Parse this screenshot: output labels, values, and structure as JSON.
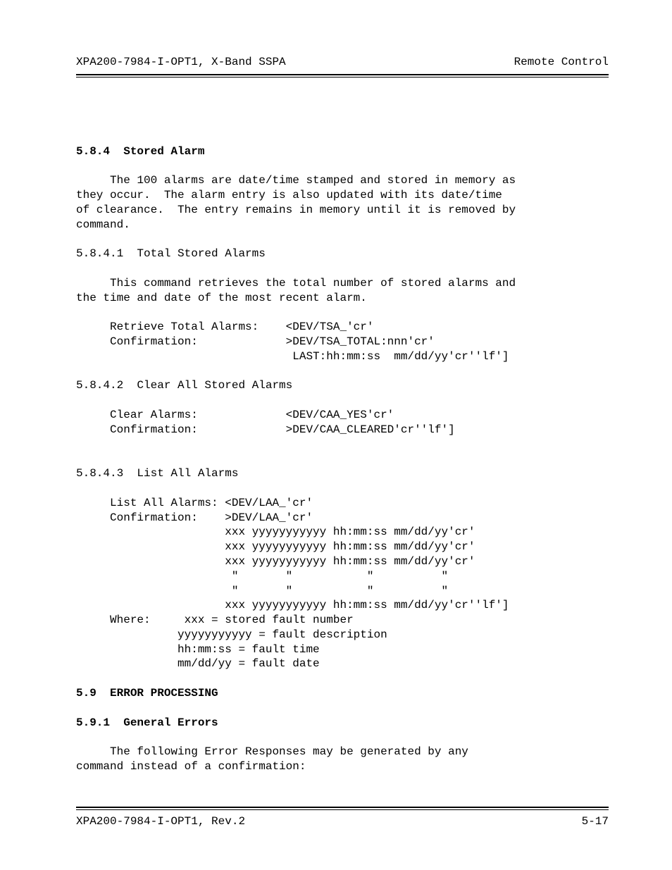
{
  "header": {
    "left": "XPA200-7984-I-OPT1, X-Band SSPA",
    "right": "Remote Control"
  },
  "footer": {
    "left": "XPA200-7984-I-OPT1, Rev.2",
    "right": "5-17"
  },
  "s584": {
    "num": "5.8.4  Stored Alarm",
    "para": "     The 100 alarms are date/time stamped and stored in memory as\nthey occur.  The alarm entry is also updated with its date/time\nof clearance.  The entry remains in memory until it is removed by\ncommand."
  },
  "s5841": {
    "title": "5.8.4.1  Total Stored Alarms",
    "para": "     This command retrieves the total number of stored alarms and\nthe time and date of the most recent alarm.",
    "block": "     Retrieve Total Alarms:    <DEV/TSA_'cr'\n     Confirmation:             >DEV/TSA_TOTAL:nnn'cr'\n                                LAST:hh:mm:ss  mm/dd/yy'cr''lf']"
  },
  "s5842": {
    "title": "5.8.4.2  Clear All Stored Alarms",
    "block": "     Clear Alarms:             <DEV/CAA_YES'cr'\n     Confirmation:             >DEV/CAA_CLEARED'cr''lf']"
  },
  "s5843": {
    "title": "5.8.4.3  List All Alarms",
    "block": "     List All Alarms: <DEV/LAA_'cr'\n     Confirmation:    >DEV/LAA_'cr'\n                      xxx yyyyyyyyyyy hh:mm:ss mm/dd/yy'cr'\n                      xxx yyyyyyyyyyy hh:mm:ss mm/dd/yy'cr'\n                      xxx yyyyyyyyyyy hh:mm:ss mm/dd/yy'cr'\n                       \"       \"           \"          \"\n                       \"       \"           \"          \"\n                      xxx yyyyyyyyyyy hh:mm:ss mm/dd/yy'cr''lf']\n     Where:     xxx = stored fault number\n               yyyyyyyyyyy = fault description\n               hh:mm:ss = fault time\n               mm/dd/yy = fault date"
  },
  "s59": {
    "title": "5.9  ERROR PROCESSING"
  },
  "s591": {
    "title": "5.9.1  General Errors",
    "para": "     The following Error Responses may be generated by any\ncommand instead of a confirmation:"
  }
}
